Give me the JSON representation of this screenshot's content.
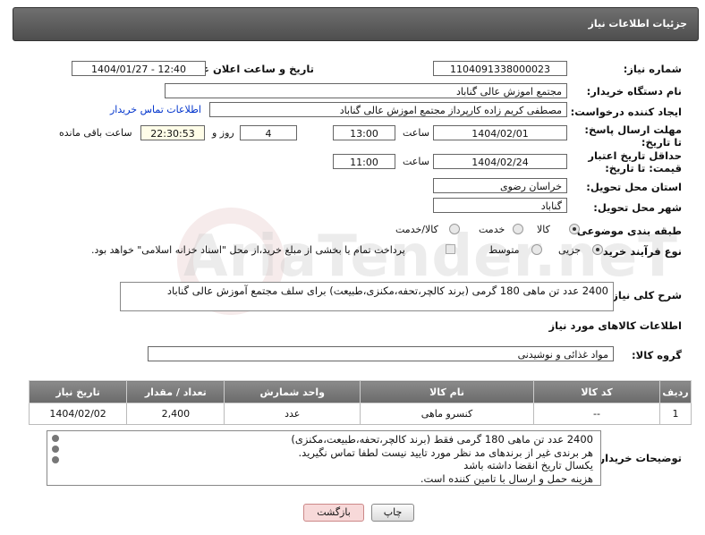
{
  "header": {
    "title": "جزئیات اطلاعات نیاز"
  },
  "fields": {
    "need_number_label": "شماره نیاز:",
    "need_number": "1104091338000023",
    "announce_label": "تاریخ و ساعت اعلان عمومی:",
    "announce_value": "1404/01/27 - 12:40",
    "buyer_org_label": "نام دستگاه خریدار:",
    "buyer_org": "مجتمع اموزش عالی گناباد",
    "creator_label": "ایجاد کننده درخواست:",
    "creator": "مصطفی کریم زاده کارپرداز مجتمع اموزش عالی گناباد",
    "contact_link": "اطلاعات تماس خریدار",
    "deadline_label": "مهلت ارسال پاسخ: تا تاریخ:",
    "deadline_date": "1404/02/01",
    "time_label": "ساعت",
    "deadline_time": "13:00",
    "days_value": "4",
    "days_label": "روز و",
    "remaining_time": "22:30:53",
    "remaining_label": "ساعت باقی مانده",
    "min_price_label": "حداقل تاریخ اعتبار قیمت: تا تاریخ:",
    "min_price_date": "1404/02/24",
    "min_price_time": "11:00",
    "province_label": "استان محل تحویل:",
    "province": "خراسان رضوی",
    "city_label": "شهر محل تحویل:",
    "city": "گناباد",
    "category_label": "طبقه بندی موضوعی:",
    "category_options": [
      "کالا",
      "خدمت",
      "کالا/خدمت"
    ],
    "category_selected": "کالا",
    "process_label": "نوع فرآیند خرید :",
    "process_options": [
      "جزیی",
      "متوسط"
    ],
    "process_selected": "جزیی",
    "payment_note": "پرداخت تمام یا بخشی از مبلغ خرید،از محل \"اسناد خزانه اسلامی\" خواهد بود.",
    "description_label": "شرح کلی نیاز:",
    "description": "2400 عدد تن ماهی 180 گرمی (برند کالچر،تحفه،مکنزی،طبیعت) برای سلف مجتمع آموزش عالی  گناباد"
  },
  "goods": {
    "section_title": "اطلاعات کالاهای مورد نیاز",
    "group_label": "گروه کالا:",
    "group_value": "مواد غذائی و نوشیدنی",
    "columns": [
      "ردیف",
      "کد کالا",
      "نام کالا",
      "واحد شمارش",
      "تعداد / مقدار",
      "تاریخ نیاز"
    ],
    "rows": [
      [
        "1",
        "--",
        "کنسرو ماهی",
        "عدد",
        "2,400",
        "1404/02/02"
      ]
    ]
  },
  "buyer_notes": {
    "label": "توضیحات خریدار:",
    "lines": [
      "2400 عدد تن ماهی 180 گرمی فقط (برند کالچر،تحفه،طبیعت،مکنزی)",
      "هر برندی غیر از برندهای مد نظر مورد تایید نیست لطفا تماس نگیرید.",
      "یکسال تاریخ انقضا داشته باشد",
      "هزینه حمل و ارسال با تامین کننده است."
    ]
  },
  "buttons": {
    "print": "چاپ",
    "back": "بازگشت"
  },
  "watermark": "AriaTender.neT",
  "colors": {
    "header_bg": "#5e5e5e",
    "link": "#0033cc",
    "back_btn_bg": "#f7d9d9"
  }
}
